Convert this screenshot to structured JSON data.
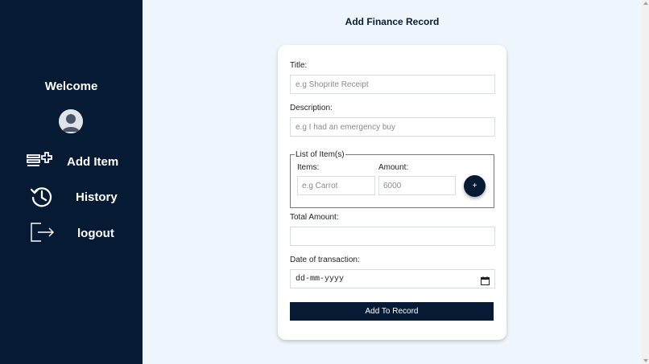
{
  "sidebar": {
    "welcome": "Welcome",
    "items": [
      {
        "label": "Add Item",
        "icon": "add-list-icon"
      },
      {
        "label": "History",
        "icon": "history-icon"
      },
      {
        "label": "logout",
        "icon": "logout-icon"
      }
    ]
  },
  "page": {
    "title": "Add Finance Record"
  },
  "form": {
    "title_label": "Title:",
    "title_placeholder": "e.g Shoprite Receipt",
    "description_label": "Description:",
    "description_placeholder": "e.g I had an emergency buy",
    "items_legend": "List of Item(s)",
    "items_label": "Items:",
    "items_placeholder": "e.g Carrot",
    "amount_label": "Amount:",
    "amount_placeholder": "6000",
    "add_item_button": "+",
    "total_label": "Total Amount:",
    "total_value": "",
    "date_label": "Date of transaction:",
    "date_placeholder": "dd-mm-yyyy",
    "submit_label": "Add To Record"
  },
  "colors": {
    "sidebar_bg": "#061b33",
    "page_bg": "#eef5fd",
    "accent": "#061b33"
  }
}
